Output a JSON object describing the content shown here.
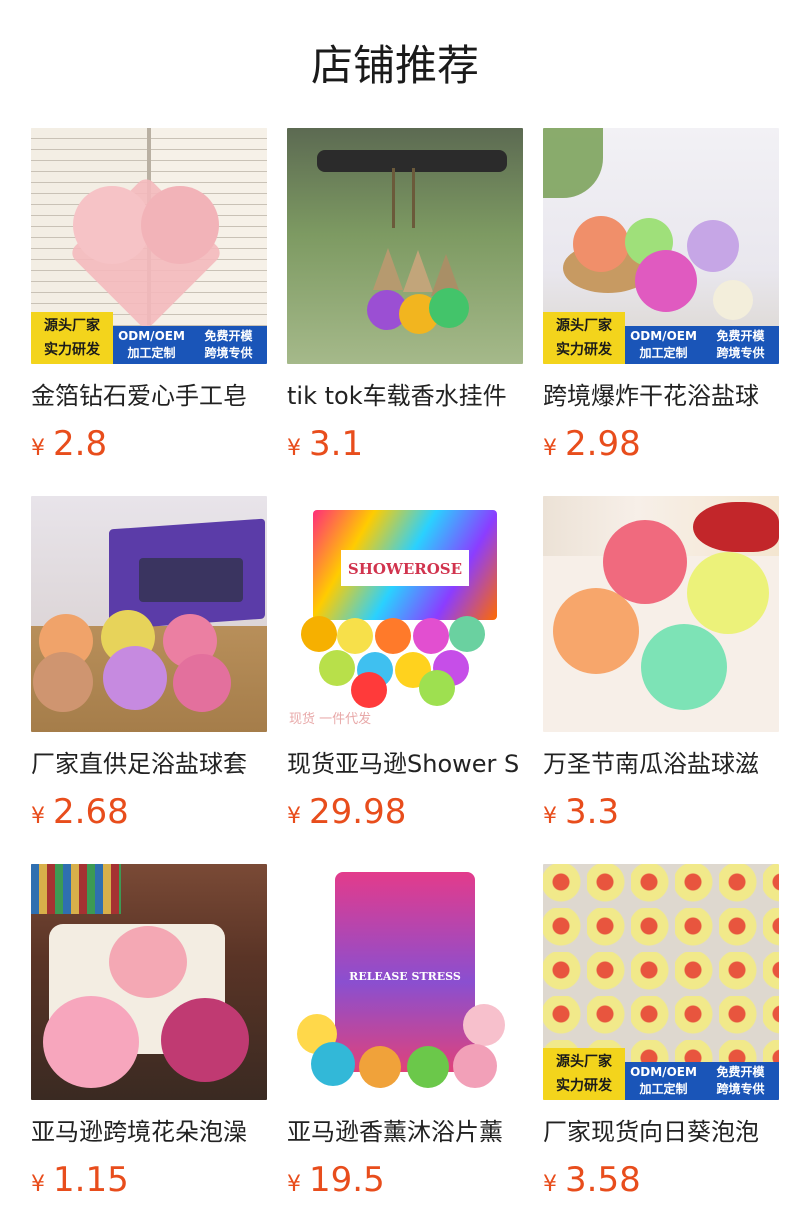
{
  "page": {
    "title": "店铺推荐"
  },
  "banner": {
    "left_line1": "源头厂家",
    "left_line2": "实力研发",
    "col1_line1": "ODM/OEM",
    "col1_line2": "加工定制",
    "col2_line1": "免费开模",
    "col2_line2": "跨境专供"
  },
  "currency": "¥",
  "products": [
    {
      "name": "金箔钻石爱心手工皂",
      "price": "2.8",
      "image": "pink-heart-soap-on-book"
    },
    {
      "name": "tik tok车载香水挂件",
      "price": "3.1",
      "image": "car-perfume-pendant"
    },
    {
      "name": "跨境爆炸干花浴盐球",
      "price": "2.98",
      "image": "flower-bath-bombs"
    },
    {
      "name": "厂家直供足浴盐球套",
      "price": "2.68",
      "image": "bath-bomb-gift-box"
    },
    {
      "name": "现货亚马逊Shower S",
      "price": "29.98",
      "image": "smiley-shower-steamers",
      "watermark": "现货 一件代发"
    },
    {
      "name": "万圣节南瓜浴盐球滋",
      "price": "3.3",
      "image": "pumpkin-bath-bombs"
    },
    {
      "name": "亚马逊跨境花朵泡澡",
      "price": "1.15",
      "image": "flower-shaped-bath-bombs"
    },
    {
      "name": "亚马逊香薰沐浴片薰",
      "price": "19.5",
      "image": "release-stress-pouch",
      "pouch_text": "RELEASE STRESS"
    },
    {
      "name": "厂家现货向日葵泡泡",
      "price": "3.58",
      "image": "sunflower-bubble-bars"
    }
  ]
}
